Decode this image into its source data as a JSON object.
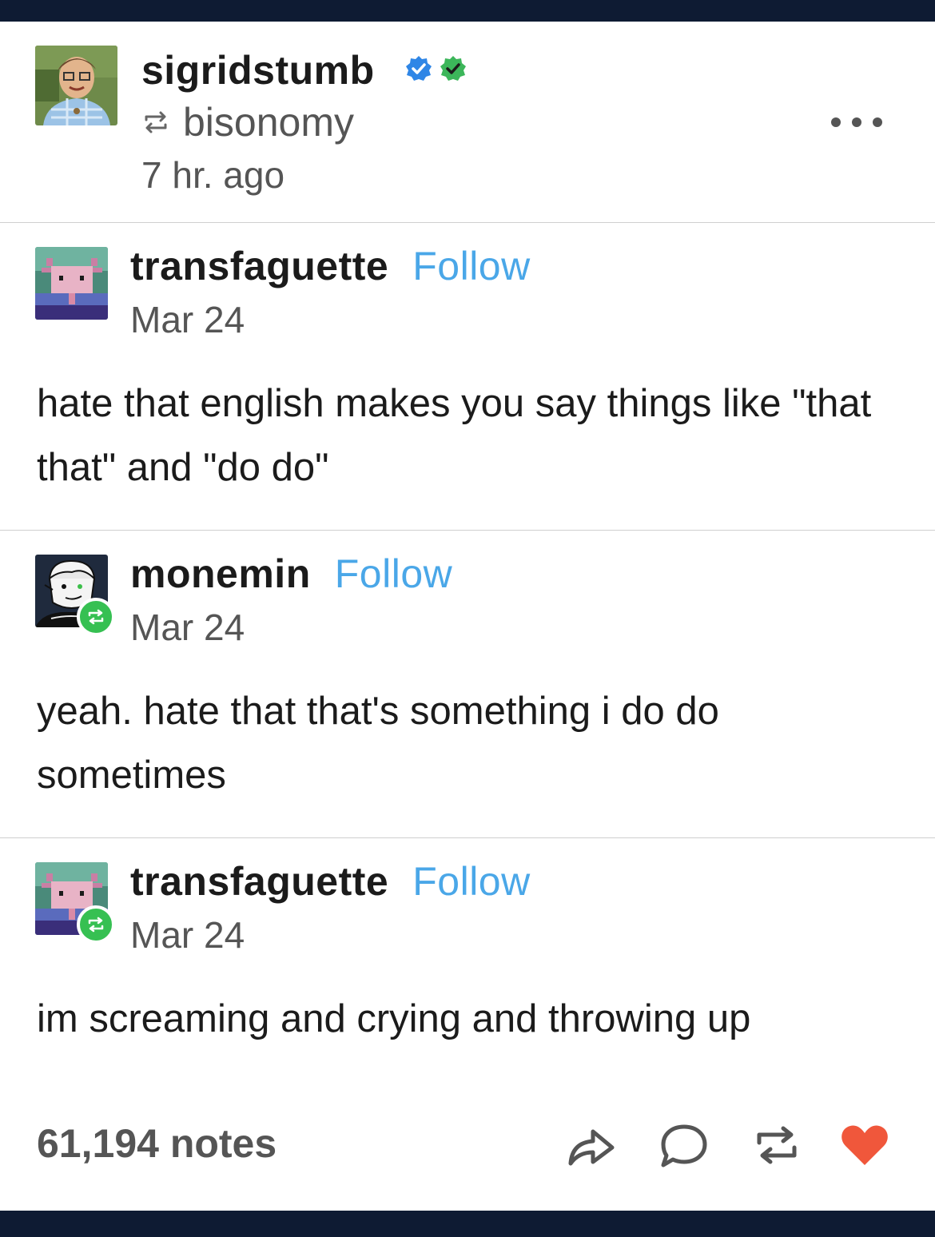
{
  "post": {
    "username": "sigridstumb",
    "reblogged_from": "bisonomy",
    "time_ago": "7 hr. ago",
    "badges": [
      {
        "icon": "verified-check-blue-icon",
        "color": "#2f86e6"
      },
      {
        "icon": "verified-check-green-icon",
        "color": "#3cb65a"
      }
    ],
    "more_icon": "more-dots-icon"
  },
  "thread": [
    {
      "username": "transfaguette",
      "follow_label": "Follow",
      "date": "Mar 24",
      "body": "hate that english makes you say things like \"that that\" and \"do do\"",
      "avatar_icon": "axolotl-avatar"
    },
    {
      "username": "monemin",
      "follow_label": "Follow",
      "date": "Mar 24",
      "body": "yeah. hate that that's something i do do sometimes",
      "avatar_icon": "drawn-character-avatar"
    },
    {
      "username": "transfaguette",
      "follow_label": "Follow",
      "date": "Mar 24",
      "body": "im screaming and crying and throwing up",
      "avatar_icon": "axolotl-avatar"
    }
  ],
  "footer": {
    "notes": "61,194 notes",
    "actions": [
      "share-icon",
      "reply-icon",
      "reblog-icon",
      "like-heart-icon"
    ],
    "like_color": "#f0573b"
  },
  "colors": {
    "follow": "#4aa7e8",
    "reblog_badge": "#36c052",
    "bar": "#0e1b33"
  }
}
